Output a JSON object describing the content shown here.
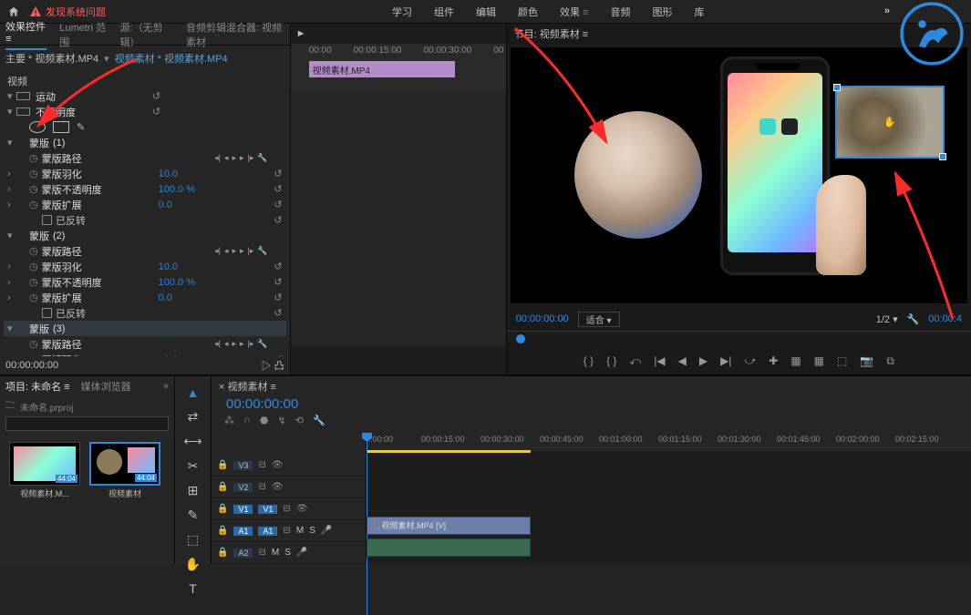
{
  "topbar": {
    "warning": "发现系统问题"
  },
  "topmenu": {
    "items": [
      "学习",
      "组件",
      "编辑",
      "颜色",
      "效果",
      "音频",
      "图形",
      "库"
    ],
    "active": 4
  },
  "effects": {
    "tabs": [
      "效果控件",
      "Lumetri 范围",
      "源:（无剪辑）",
      "音频剪辑混合器: 视频素材"
    ],
    "active": 0,
    "master": "主要 * 视频素材.MP4",
    "dd": "视频素材 * 视频素材.MP4",
    "section": "视频",
    "motion": "运动",
    "opacity": "不透明度",
    "mask_label": "蒙版",
    "path": "蒙版路径",
    "feather": "蒙版羽化",
    "mask_op": "蒙版不透明度",
    "expand": "蒙版扩展",
    "invert": "已反转",
    "v_feather": "10.0",
    "v_op": "100.0 %",
    "v_expand": "0.0",
    "tc": "00:00:00:00"
  },
  "mini_tl": {
    "play": "►",
    "tcs": [
      "00:00",
      "00:00:15:00",
      "00:00:30:00",
      "00"
    ],
    "clip": "视频素材.MP4"
  },
  "program": {
    "tab": "节目: 视频素材",
    "tc": "00:00:00:00",
    "fit": "适合",
    "ratio": "1/2",
    "tc2": "00:00:4"
  },
  "transport": {
    "btns": [
      "{ }",
      "{ }",
      "⤺",
      "|◀",
      "◀",
      "▶",
      "▶|",
      "⤻",
      "✚",
      "▦",
      "▦",
      "⬚",
      "📷",
      "⧉"
    ]
  },
  "project": {
    "tabs": [
      "项目: 未命名",
      "媒体浏览器"
    ],
    "active": 0,
    "file": "未命名.prproj",
    "search_ph": "",
    "bin1": "视频素材.M...",
    "bin2": "视频素材",
    "dur": "44:04"
  },
  "tools": [
    "▲",
    "⇄",
    "✂",
    "⊞",
    "✎",
    "⬚",
    "✋",
    "T"
  ],
  "timeline": {
    "tab": "× 视频素材",
    "tc": "00:00:00:00",
    "ruler": [
      ":00:00",
      "00:00:15:00",
      "00:00:30:00",
      "00:00:45:00",
      "00:01:00:00",
      "00:01:15:00",
      "00:01:30:00",
      "00:01:45:00",
      "00:02:00:00",
      "00:02:15:00"
    ],
    "tracks": {
      "v3": "V3",
      "v2": "V2",
      "v1": "V1",
      "a1": "A1",
      "a2": "A2"
    },
    "clip_v": "视频素材.MP4 [V]"
  }
}
